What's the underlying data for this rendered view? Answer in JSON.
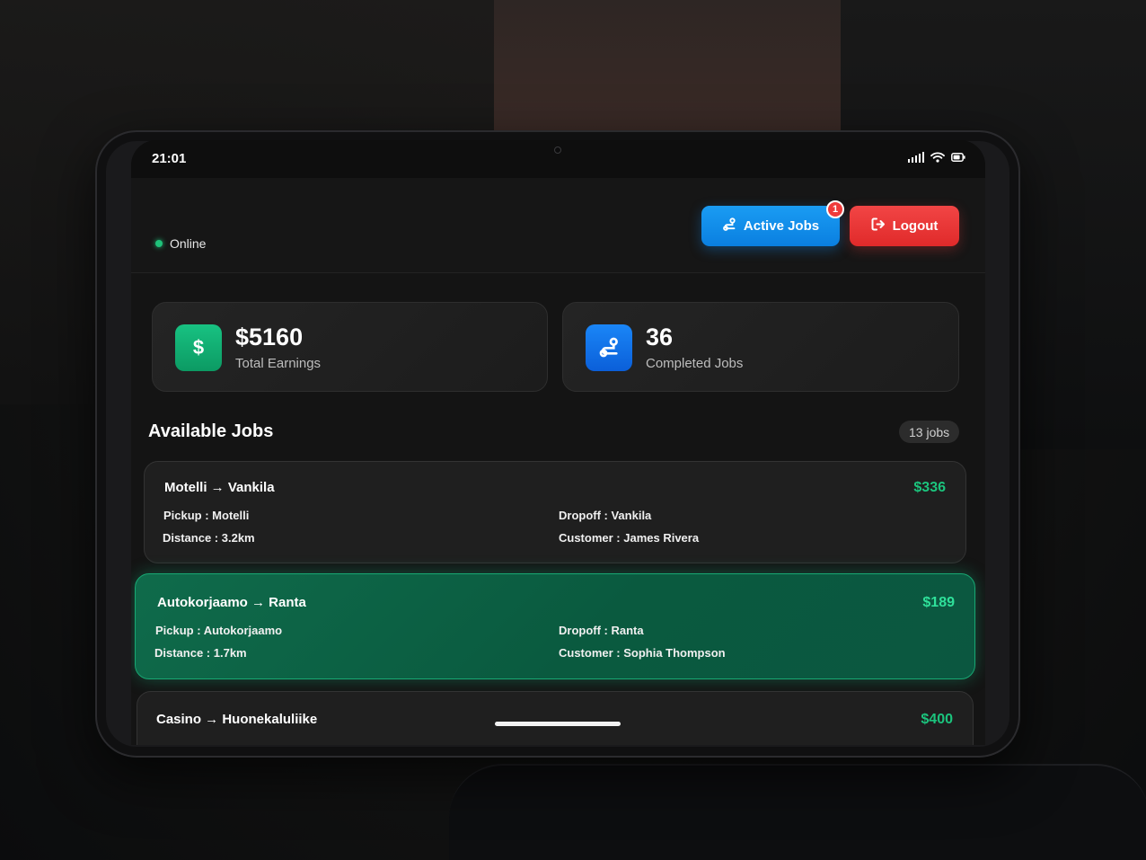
{
  "status_bar": {
    "time": "21:01"
  },
  "header": {
    "status_text": "Online",
    "active_jobs_label": "Active Jobs",
    "active_jobs_badge": "1",
    "logout_label": "Logout"
  },
  "stats": [
    {
      "value": "$5160",
      "label": "Total Earnings",
      "icon": "dollar-icon"
    },
    {
      "value": "36",
      "label": "Completed Jobs",
      "icon": "route-icon"
    }
  ],
  "jobs_section": {
    "title": "Available Jobs",
    "count": "13 jobs"
  },
  "jobs": [
    {
      "route": "Motelli → Vankila",
      "price": "$336",
      "pickup": "Pickup : Motelli",
      "dropoff": "Dropoff : Vankila",
      "distance": "Distance : 3.2km",
      "customer": "Customer : James Rivera",
      "selected": false
    },
    {
      "route": "Autokorjaamo → Ranta",
      "price": "$189",
      "pickup": "Pickup : Autokorjaamo",
      "dropoff": "Dropoff : Ranta",
      "distance": "Distance : 1.7km",
      "customer": "Customer : Sophia Thompson",
      "selected": true
    },
    {
      "route": "Casino → Huonekaluliike",
      "price": "$400",
      "selected": false
    }
  ],
  "colors": {
    "accent_green": "#1bc47d",
    "accent_blue": "#0a7fe0",
    "accent_red": "#e02a2a",
    "selected_card": "#0f6b4b"
  }
}
